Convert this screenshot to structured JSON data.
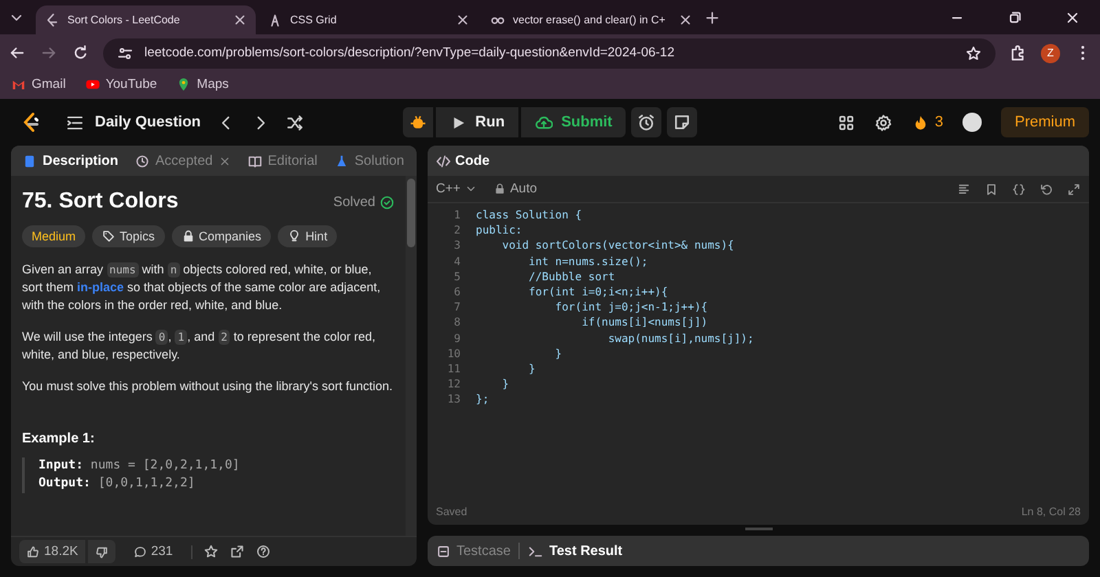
{
  "browser": {
    "tabs": [
      {
        "title": "Sort Colors - LeetCode",
        "selected": true
      },
      {
        "title": "CSS Grid",
        "selected": false
      },
      {
        "title": "vector erase() and clear() in C+",
        "selected": false
      }
    ],
    "url": "leetcode.com/problems/sort-colors/description/?envType=daily-question&envId=2024-06-12",
    "profile_initial": "Z",
    "bookmarks": [
      "Gmail",
      "YouTube",
      "Maps"
    ]
  },
  "nav": {
    "title": "Daily Question",
    "run": "Run",
    "submit": "Submit",
    "streak": "3",
    "premium": "Premium"
  },
  "problem": {
    "tabs": [
      {
        "label": "Description",
        "selected": true
      },
      {
        "label": "Accepted",
        "selected": false
      },
      {
        "label": "Editorial",
        "selected": false
      },
      {
        "label": "Solution",
        "selected": false
      }
    ],
    "title": "75. Sort Colors",
    "status": "Solved",
    "tags": [
      {
        "label": "Medium",
        "kind": "difficulty"
      },
      {
        "label": "Topics",
        "kind": "topics"
      },
      {
        "label": "Companies",
        "kind": "companies"
      },
      {
        "label": "Hint",
        "kind": "hint"
      }
    ],
    "paragraphs": [
      [
        {
          "kind": "text",
          "text": "Given an array "
        },
        {
          "kind": "code",
          "text": "nums"
        },
        {
          "kind": "text",
          "text": " with "
        },
        {
          "kind": "code",
          "text": "n"
        },
        {
          "kind": "text",
          "text": " objects colored red, white, or blue, sort them "
        },
        {
          "kind": "link",
          "text": "in-place"
        },
        {
          "kind": "text",
          "text": " so that objects of the same color are adjacent, with the colors in the order red, white, and blue."
        }
      ],
      [
        {
          "kind": "text",
          "text": "We will use the integers "
        },
        {
          "kind": "code",
          "text": "0"
        },
        {
          "kind": "text",
          "text": ", "
        },
        {
          "kind": "code",
          "text": "1"
        },
        {
          "kind": "text",
          "text": ", and "
        },
        {
          "kind": "code",
          "text": "2"
        },
        {
          "kind": "text",
          "text": " to represent the color red, white, and blue, respectively."
        }
      ],
      [
        {
          "kind": "text",
          "text": "You must solve this problem without using the library's sort function."
        }
      ]
    ],
    "example": {
      "title": "Example 1:",
      "lines": [
        {
          "label": "Input:",
          "value": "nums = [2,0,2,1,1,0]"
        },
        {
          "label": "Output:",
          "value": "[0,0,1,1,2,2]"
        }
      ]
    },
    "likes": "18.2K",
    "comments": "231"
  },
  "editor": {
    "title": "Code",
    "language": "C++",
    "mode": "Auto",
    "lines": [
      {
        "number": "1",
        "code": "class Solution {"
      },
      {
        "number": "2",
        "code": "public:"
      },
      {
        "number": "3",
        "code": "    void sortColors(vector<int>& nums){"
      },
      {
        "number": "4",
        "code": "        int n=nums.size();"
      },
      {
        "number": "5",
        "code": "        //Bubble sort"
      },
      {
        "number": "6",
        "code": "        for(int i=0;i<n;i++){"
      },
      {
        "number": "7",
        "code": "            for(int j=0;j<n-1;j++){"
      },
      {
        "number": "8",
        "code": "                if(nums[i]<nums[j])"
      },
      {
        "number": "9",
        "code": "                    swap(nums[i],nums[j]);"
      },
      {
        "number": "10",
        "code": "            }"
      },
      {
        "number": "11",
        "code": "        }"
      },
      {
        "number": "12",
        "code": "    }"
      },
      {
        "number": "13",
        "code": "};"
      }
    ],
    "saved": "Saved",
    "cursor": "Ln 8, Col 28"
  },
  "console": {
    "tabs": [
      {
        "label": "Testcase",
        "selected": false
      },
      {
        "label": "Test Result",
        "selected": true
      }
    ]
  }
}
